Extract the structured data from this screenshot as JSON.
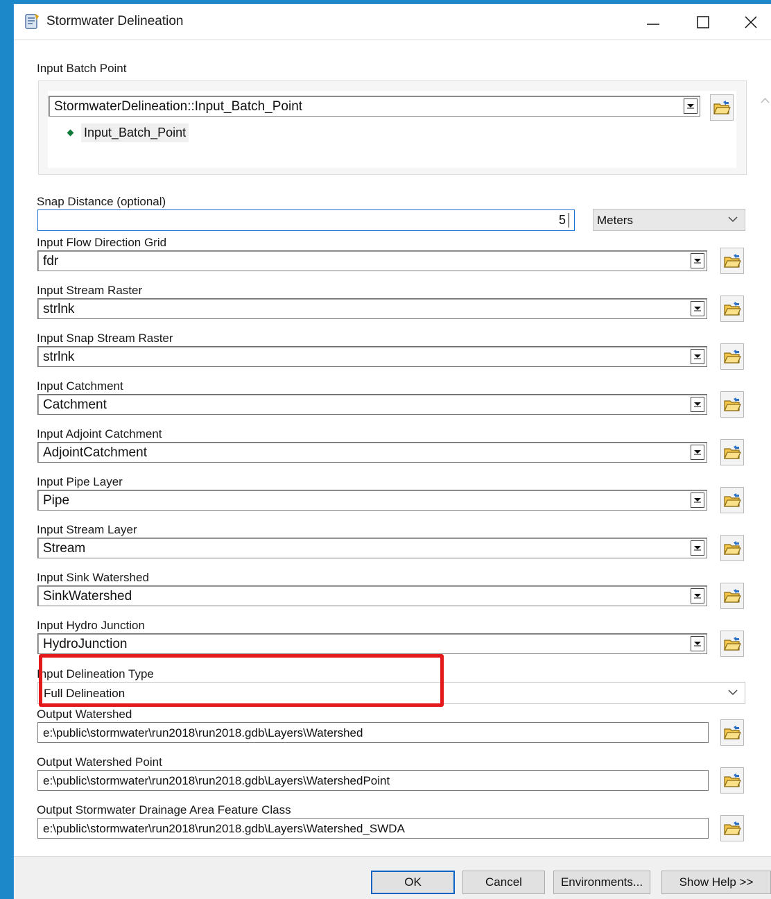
{
  "window": {
    "title": "Stormwater Delineation",
    "icon": "toolbox-script-icon"
  },
  "input_batch_point": {
    "label": "Input Batch Point",
    "value": "StormwaterDelineation::Input_Batch_Point",
    "items": [
      "Input_Batch_Point"
    ]
  },
  "snap_distance": {
    "label": "Snap Distance (optional)",
    "value": "5",
    "unit": "Meters"
  },
  "layer_inputs": [
    {
      "label": "Input Flow Direction Grid",
      "value": "fdr"
    },
    {
      "label": "Input Stream Raster",
      "value": "strlnk"
    },
    {
      "label": "Input Snap Stream Raster",
      "value": "strlnk"
    },
    {
      "label": "Input Catchment",
      "value": "Catchment"
    },
    {
      "label": "Input Adjoint Catchment",
      "value": "AdjointCatchment"
    },
    {
      "label": "Input Pipe Layer",
      "value": "Pipe"
    },
    {
      "label": "Input Stream Layer",
      "value": "Stream"
    },
    {
      "label": "Input Sink Watershed",
      "value": "SinkWatershed"
    },
    {
      "label": "Input Hydro Junction",
      "value": "HydroJunction"
    }
  ],
  "delineation_type": {
    "label": "Input Delineation Type",
    "value": "Full Delineation"
  },
  "outputs": [
    {
      "label": "Output Watershed",
      "value": "e:\\public\\stormwater\\run2018\\run2018.gdb\\Layers\\Watershed"
    },
    {
      "label": "Output Watershed Point",
      "value": "e:\\public\\stormwater\\run2018\\run2018.gdb\\Layers\\WatershedPoint"
    },
    {
      "label": "Output Stormwater Drainage Area Feature Class",
      "value": "e:\\public\\stormwater\\run2018\\run2018.gdb\\Layers\\Watershed_SWDA"
    }
  ],
  "buttons": {
    "ok": "OK",
    "cancel": "Cancel",
    "environments": "Environments...",
    "show_help": "Show Help >>"
  },
  "colors": {
    "highlight": "#e4191c",
    "desktop": "#1c87c9",
    "focus": "#1a6fd0"
  }
}
